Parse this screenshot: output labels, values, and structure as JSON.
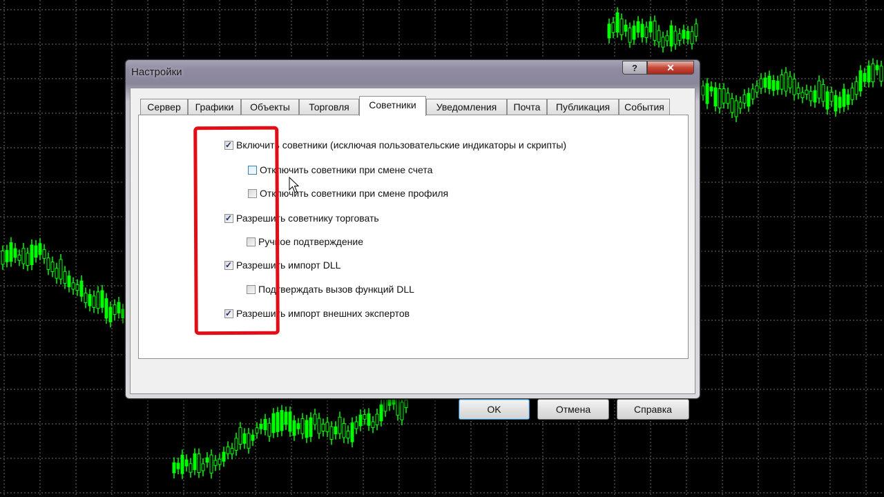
{
  "dialog": {
    "title": "Настройки",
    "caption_help": "?",
    "caption_close": "✕"
  },
  "tabs": [
    {
      "label": "Сервер",
      "active": false
    },
    {
      "label": "Графики",
      "active": false
    },
    {
      "label": "Объекты",
      "active": false
    },
    {
      "label": "Торговля",
      "active": false
    },
    {
      "label": "Советники",
      "active": true
    },
    {
      "label": "Уведомления",
      "active": false
    },
    {
      "label": "Почта",
      "active": false
    },
    {
      "label": "Публикация",
      "active": false
    },
    {
      "label": "События",
      "active": false
    }
  ],
  "options": [
    {
      "label": "Включить советники (исключая пользовательские индикаторы и скрипты)",
      "checked": true
    },
    {
      "label": "Отключить советники при смене счета",
      "checked": false
    },
    {
      "label": "Отключить советники при смене профиля",
      "checked": false
    },
    {
      "label": "Разрешить советнику торговать",
      "checked": true
    },
    {
      "label": "Ручное подтверждение",
      "checked": false
    },
    {
      "label": "Разрешить импорт DLL",
      "checked": true
    },
    {
      "label": "Подтверждать вызов функций DLL",
      "checked": false
    },
    {
      "label": "Разрешить импорт внешних экспертов",
      "checked": true
    }
  ],
  "buttons": {
    "ok": "OK",
    "cancel": "Отмена",
    "help": "Справка"
  },
  "colors": {
    "chart_background": "#000000",
    "candle": "#00ff00",
    "grid": "#6f6f6f",
    "annotation": "#e10e18"
  }
}
